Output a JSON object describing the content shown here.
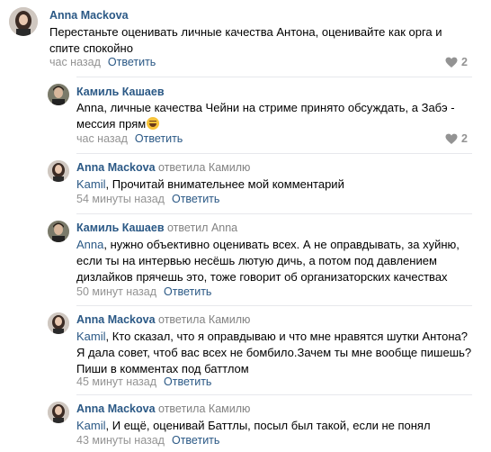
{
  "comments": [
    {
      "author": "Anna Mackova",
      "replied_text": "",
      "replied_to": "",
      "mention": "",
      "text": "Перестаньте оценивать личные качества Антона, оценивайте как орга и спите спокойно",
      "time": "час назад",
      "reply_label": "Ответить",
      "likes": "2",
      "avatar": "female"
    },
    {
      "author": "Камиль Кашаев",
      "replied_text": "",
      "replied_to": "",
      "mention": "",
      "text": "Anna, личные качества Чейни на стриме принято обсуждать, а Забэ - месcия прям",
      "time": "час назад",
      "reply_label": "Ответить",
      "likes": "2",
      "avatar": "male",
      "emoji": "rolling-laughing-emoji"
    },
    {
      "author": "Anna Mackova",
      "replied_text": "ответила",
      "replied_to": "Камилю",
      "mention": "Kamil",
      "text": ", Прочитай внимательнее мой комментарий",
      "time": "54 минуты назад",
      "reply_label": "Ответить",
      "avatar": "female"
    },
    {
      "author": "Камиль Кашаев",
      "replied_text": "ответил",
      "replied_to": "Anna",
      "mention": "Anna",
      "text": ", нужно объективно оценивать всех. А не оправдывать, за хуйню, если ты на интервью несёшь лютую дичь, а потом под давлением дизлайков прячешь это, тоже говорит об организаторских качествах",
      "time": "50 минут назад",
      "reply_label": "Ответить",
      "avatar": "male"
    },
    {
      "author": "Anna Mackova",
      "replied_text": "ответила",
      "replied_to": "Камилю",
      "mention": "Kamil",
      "text": ", Кто сказал, что я оправдываю и что мне нравятся шутки Антона? Я дала совет, чтоб вас всех не бомбило.Зачем ты мне вообще пишешь? Пиши в комментах под баттлом",
      "time": "45 минут назад",
      "reply_label": "Ответить",
      "avatar": "female"
    },
    {
      "author": "Anna Mackova",
      "replied_text": "ответила",
      "replied_to": "Камилю",
      "mention": "Kamil",
      "text": ", И ещё, оценивай Баттлы, посыл был такой, если не понял",
      "time": "43 минуты назад",
      "reply_label": "Ответить",
      "avatar": "female"
    }
  ],
  "colors": {
    "link": "#2a5885",
    "meta": "#939393",
    "divider": "#e7e8ec"
  },
  "icons": {
    "like": "heart-icon"
  }
}
